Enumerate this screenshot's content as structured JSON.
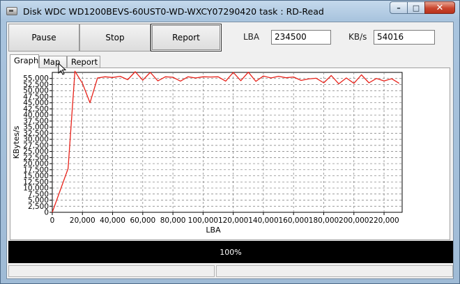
{
  "window": {
    "title": "Disk WDC WD1200BEVS-60UST0-WD-WXCY07290420   task : RD-Read",
    "caption": {
      "minimize": "–",
      "maximize": "□",
      "close": "✕"
    }
  },
  "toolbar": {
    "pause_label": "Pause",
    "stop_label": "Stop",
    "report_label": "Report",
    "lba_label": "LBA",
    "lba_value": "234500",
    "kbs_label": "KB/s",
    "kbs_value": "54016"
  },
  "tabs": [
    {
      "label": "Graph",
      "active": true
    },
    {
      "label": "Map",
      "active": false
    },
    {
      "label": "Report",
      "active": false
    }
  ],
  "chart_data": {
    "type": "line",
    "xlabel": "LBA",
    "ylabel": "KBytes/s",
    "xlim": [
      0,
      232000
    ],
    "ylim": [
      0,
      57500
    ],
    "xticks": [
      "0",
      "20,000",
      "40,000",
      "60,000",
      "80,000",
      "100,000",
      "120,000",
      "140,000",
      "160,000",
      "180,000",
      "200,000",
      "220,000"
    ],
    "yticks": [
      "0",
      "2,500",
      "5,000",
      "7,500",
      "10,000",
      "12,500",
      "15,000",
      "17,500",
      "20,000",
      "22,500",
      "25,000",
      "27,500",
      "30,000",
      "32,500",
      "35,000",
      "37,500",
      "40,000",
      "42,500",
      "45,000",
      "47,500",
      "50,000",
      "52,500",
      "55,000"
    ],
    "grid": true,
    "line_color": "#e8221a",
    "series": [
      {
        "x": [
          0,
          10500,
          15000,
          20000,
          25000,
          30000,
          35000,
          40000,
          45000,
          50000,
          55000,
          60000,
          65000,
          70000,
          75000,
          80000,
          85000,
          90000,
          95000,
          100000,
          105000,
          110000,
          115000,
          120000,
          125000,
          130000,
          135000,
          140000,
          145000,
          150000,
          155000,
          160000,
          165000,
          170000,
          175000,
          180000,
          185000,
          190000,
          195000,
          200000,
          205000,
          210000,
          215000,
          220000,
          225000,
          230000
        ],
        "y": [
          0,
          18000,
          58000,
          53000,
          45000,
          55200,
          55700,
          55400,
          55900,
          54500,
          57800,
          54300,
          57500,
          54000,
          55700,
          55500,
          53900,
          55700,
          55200,
          55700,
          55600,
          55700,
          53900,
          57500,
          54100,
          57600,
          53800,
          56000,
          55200,
          55900,
          55300,
          55600,
          54200,
          54800,
          55100,
          53200,
          56200,
          52800,
          55200,
          53000,
          56500,
          53200,
          55000,
          54000,
          54900,
          53000
        ]
      }
    ]
  },
  "progress": {
    "text": "100%",
    "value": 1.0
  }
}
